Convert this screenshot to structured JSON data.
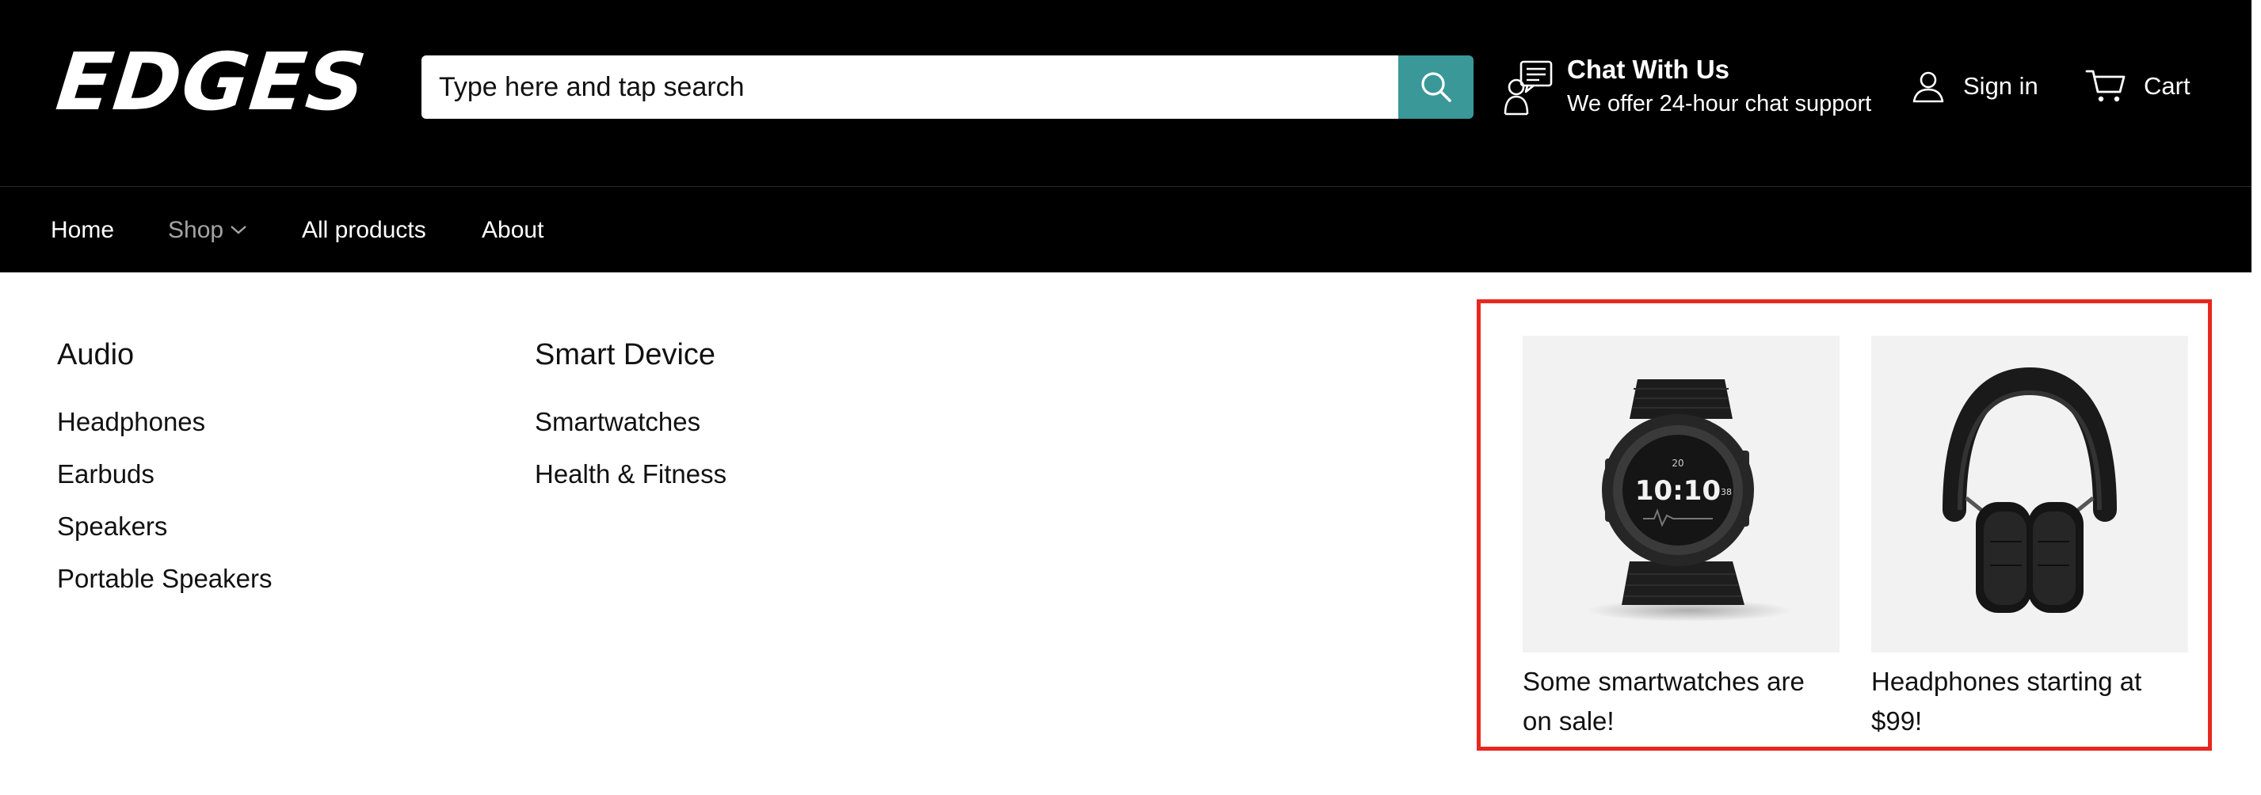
{
  "brand": {
    "logo_text": "EDGES"
  },
  "search": {
    "placeholder": "Type here and tap search"
  },
  "chat": {
    "title": "Chat With Us",
    "subtitle": "We offer 24-hour chat support"
  },
  "account": {
    "signin_label": "Sign in",
    "cart_label": "Cart"
  },
  "nav": {
    "items": [
      {
        "label": "Home"
      },
      {
        "label": "Shop"
      },
      {
        "label": "All products"
      },
      {
        "label": "About"
      }
    ]
  },
  "menu": {
    "columns": [
      {
        "title": "Audio",
        "links": [
          "Headphones",
          "Earbuds",
          "Speakers",
          "Portable Speakers"
        ]
      },
      {
        "title": "Smart Device",
        "links": [
          "Smartwatches",
          "Health & Fitness"
        ]
      }
    ],
    "promos": [
      {
        "caption": "Some smartwatches are on sale!",
        "image": "smartwatch-image"
      },
      {
        "caption": "Headphones starting at $99!",
        "image": "headphones-image"
      }
    ]
  },
  "colors": {
    "header_bg": "#000000",
    "search_button": "#3a9898",
    "highlight_border": "#e8271f",
    "promo_image_bg": "#f2f2f2",
    "nav_active_text": "#a4a4a4"
  },
  "icons": [
    "search-icon",
    "chat-support-icon",
    "user-icon",
    "cart-icon",
    "chevron-down-icon"
  ]
}
